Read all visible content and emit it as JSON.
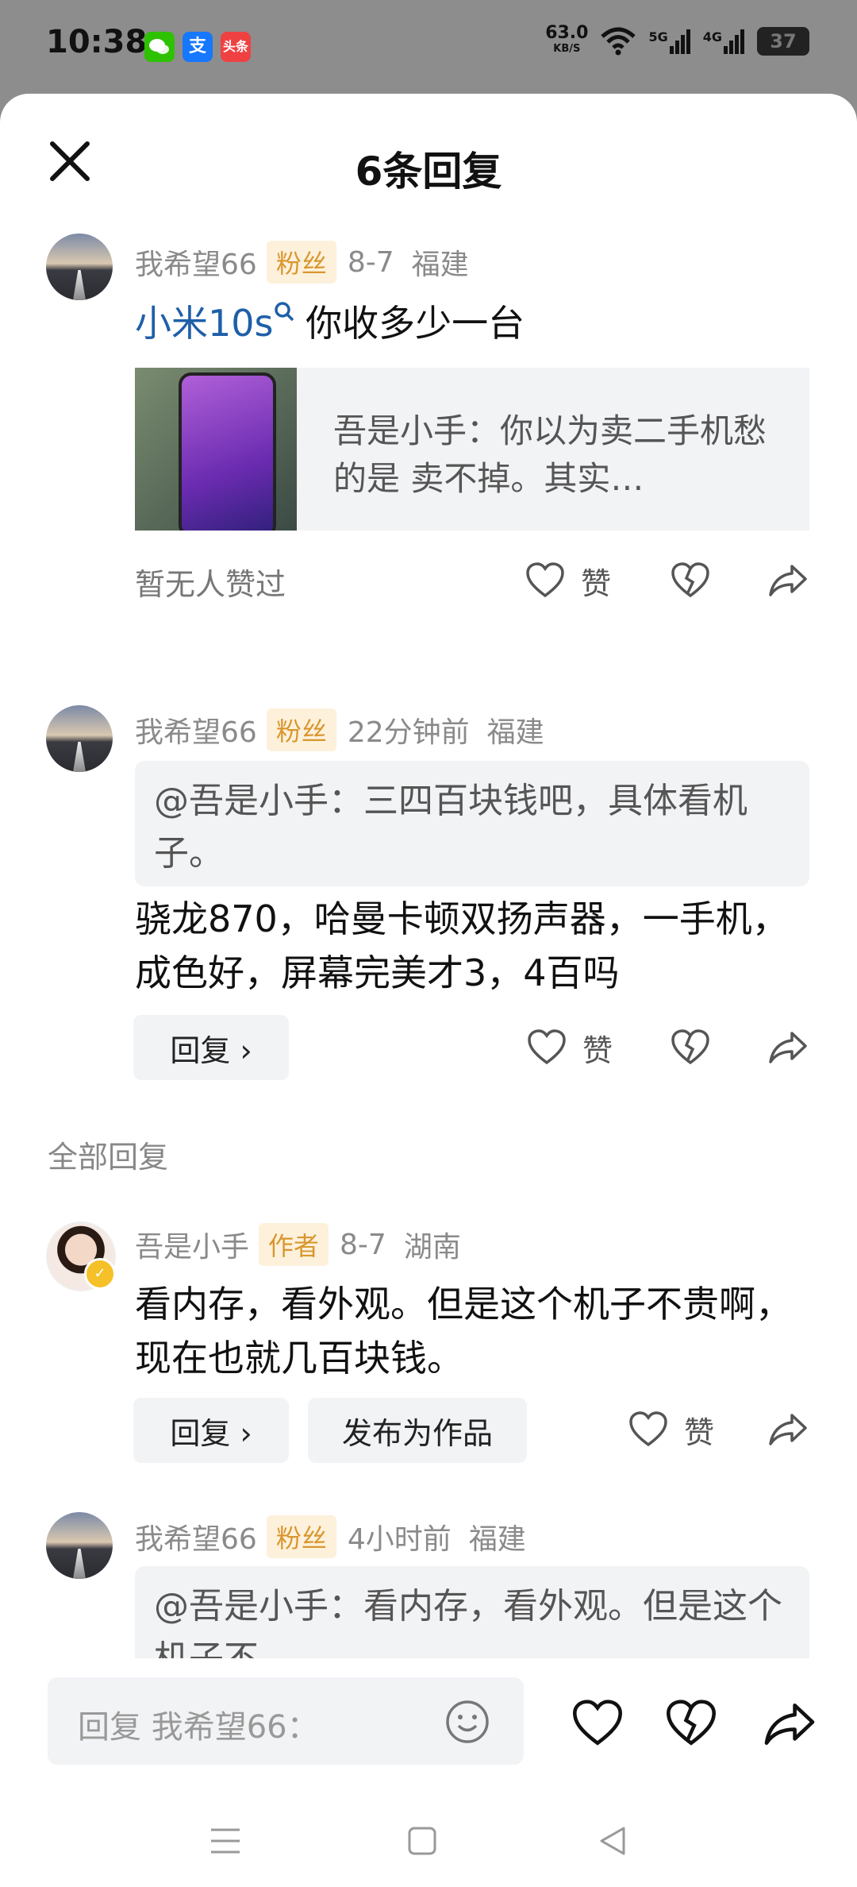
{
  "status": {
    "time": "10:38",
    "app_icons": [
      {
        "name": "wechat-icon",
        "label": "",
        "color": "#2dc100"
      },
      {
        "name": "alipay-icon",
        "label": "支",
        "color": "#1677ff"
      },
      {
        "name": "toutiao-icon",
        "label": "头条",
        "color": "#f04142"
      }
    ],
    "net_speed": "63.0",
    "net_unit": "KB/S",
    "sig1": "5G",
    "sig2": "4G",
    "battery": "37"
  },
  "header": {
    "title": "6条回复"
  },
  "comments": [
    {
      "user": "我希望66",
      "tag": "粉丝",
      "time": "8-7",
      "location": "福建",
      "link_text": "小米10s",
      "text": "你收多少一台",
      "card_text": "吾是小手：你以为卖二手机愁的是 卖不掉。其实…",
      "no_likes": "暂无人赞过",
      "like_label": "赞"
    },
    {
      "user": "我希望66",
      "tag": "粉丝",
      "time": "22分钟前",
      "location": "福建",
      "quote": "@吾是小手：三四百块钱吧，具体看机子。",
      "text": "骁龙870，哈曼卡顿双扬声器，一手机，成色好，屏幕完美才3，4百吗",
      "reply_label": "回复 ›",
      "like_label": "赞"
    }
  ],
  "section_label": "全部回复",
  "replies": [
    {
      "user": "吾是小手",
      "tag": "作者",
      "time": "8-7",
      "location": "湖南",
      "text": "看内存，看外观。但是这个机子不贵啊，现在也就几百块钱。",
      "reply_label": "回复 ›",
      "publish_label": "发布为作品",
      "like_label": "赞"
    },
    {
      "user": "我希望66",
      "tag": "粉丝",
      "time": "4小时前",
      "location": "福建",
      "quote": "@吾是小手：看内存，看外观。但是这个机子不"
    }
  ],
  "input": {
    "placeholder": "回复 我希望66："
  },
  "colors": {
    "accent_link": "#1f5fa8",
    "tag_bg": "#fdf1dc",
    "tag_text": "#d9972f",
    "surface": "#f2f3f5"
  }
}
